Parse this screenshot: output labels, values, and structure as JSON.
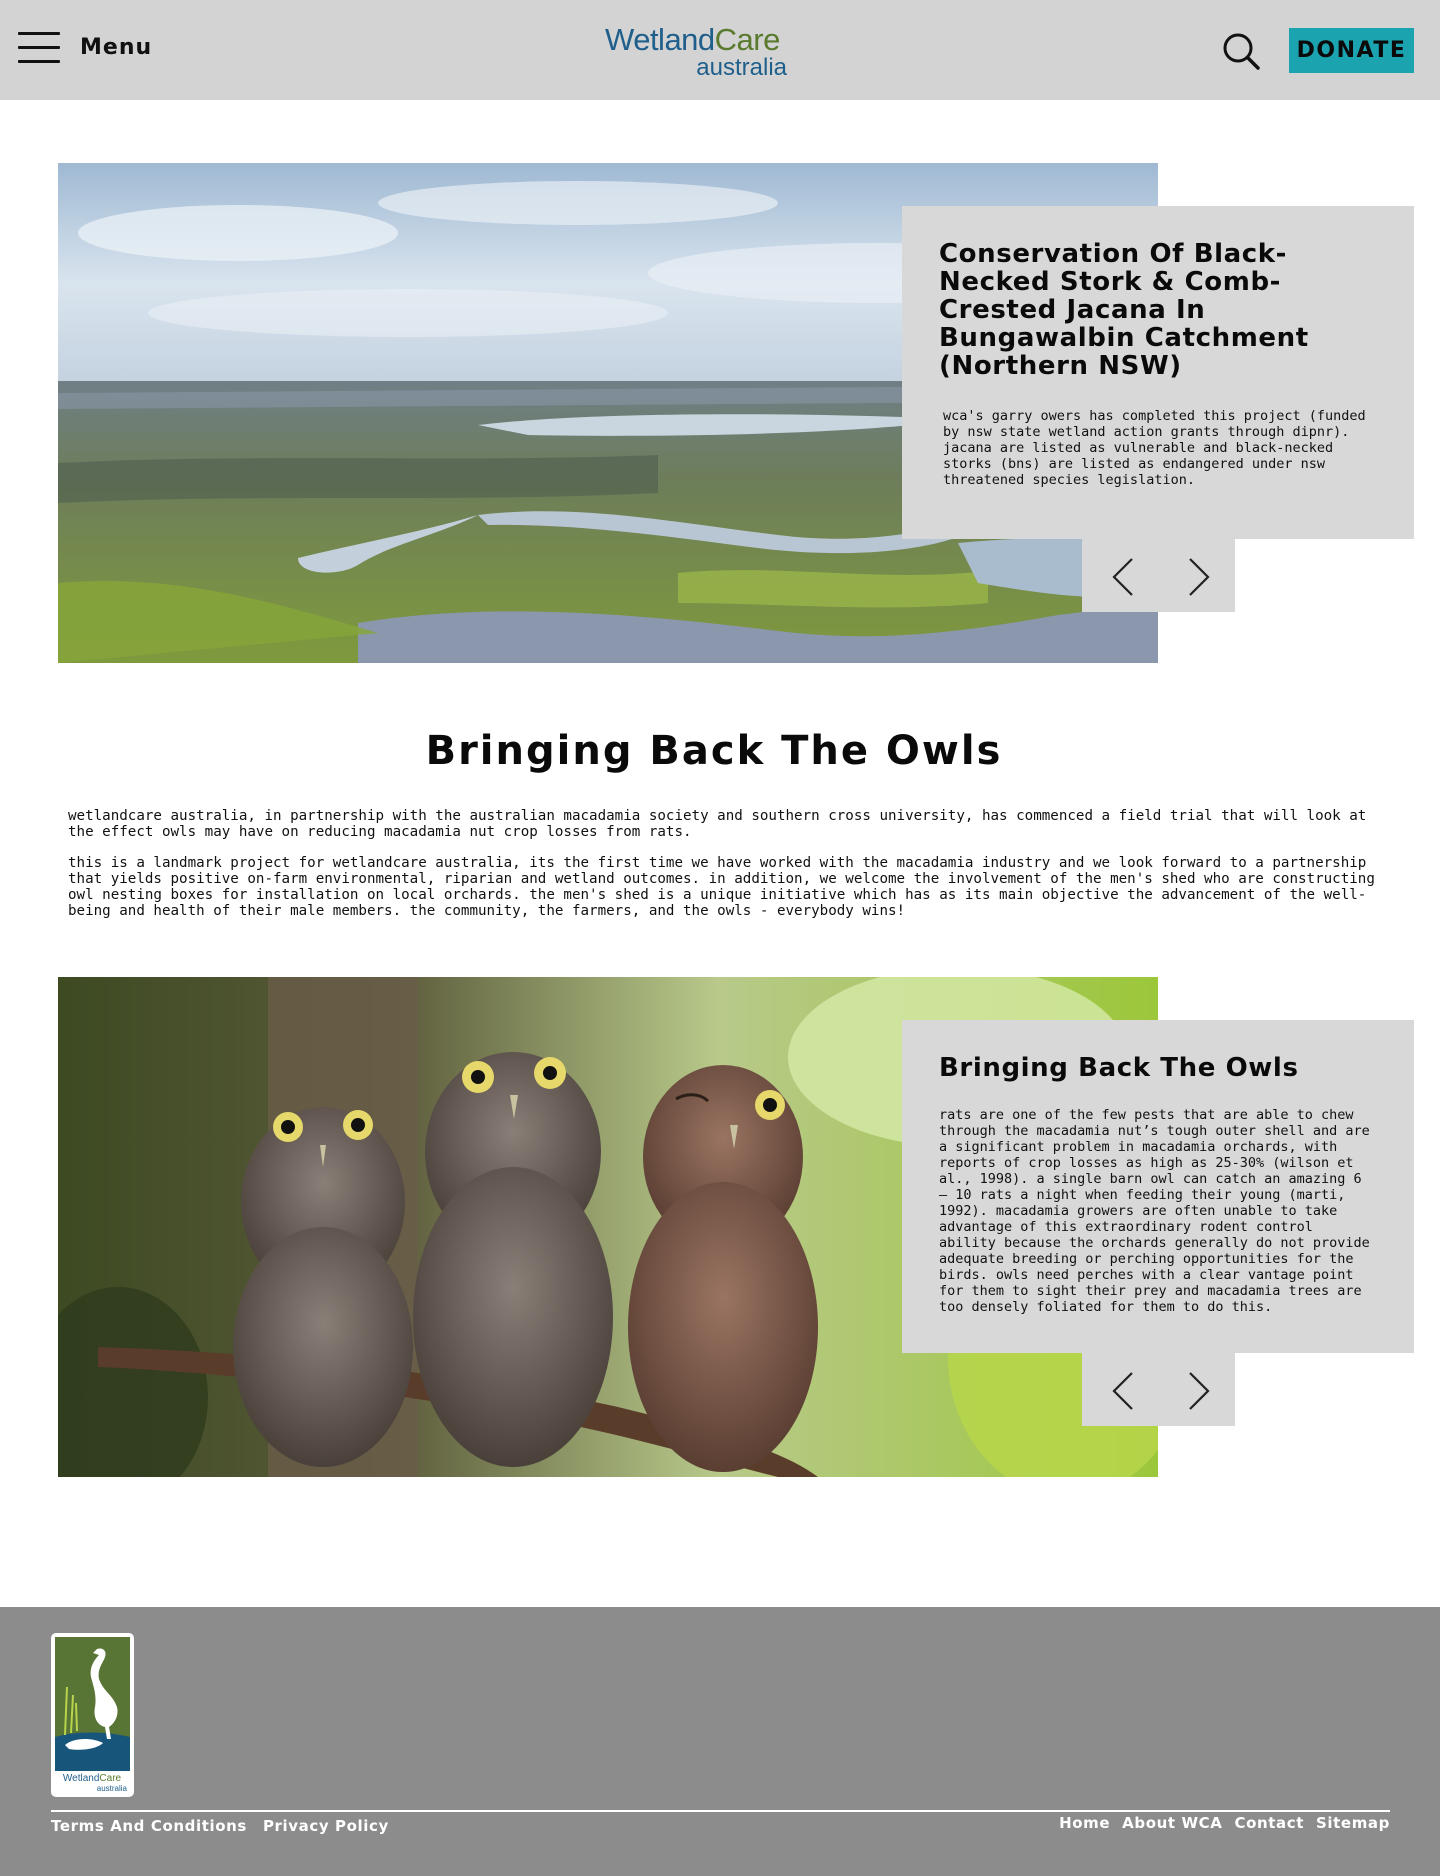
{
  "header": {
    "menu_label": "Menu",
    "logo_word1": "Wetland",
    "logo_word2": "Care",
    "logo_sub": "australia",
    "donate_label": "DONATE"
  },
  "colors": {
    "header_bg": "#d3d3d3",
    "donate_bg": "#1ba3b0",
    "brand_blue": "#1f5f8b",
    "brand_green": "#5a7a2e",
    "panel_bg": "#d8d8d8",
    "footer_bg": "#8c8c8c"
  },
  "icons": [
    "menu-icon",
    "search-icon",
    "chevron-left-icon",
    "chevron-right-icon"
  ],
  "slider1": {
    "image": "aerial-wetland-photo",
    "title": "Conservation Of Black-Necked Stork & Comb-Crested Jacana In Bungawalbin Catchment (Northern NSW)",
    "text": "wca's garry owers has completed this project (funded by nsw state wetland action grants through dipnr). jacana are listed as vulnerable and black-necked storks (bns) are listed as endangered under nsw threatened species legislation."
  },
  "main": {
    "title": "Bringing Back The Owls",
    "paragraphs": [
      "wetlandcare australia, in partnership with the australian macadamia society and southern cross university, has commenced a field trial that will look at the effect owls may have on reducing macadamia nut crop losses from rats.",
      "this is a landmark project for wetlandcare australia, its the first time we have worked with the macadamia industry and we look forward to a partnership that yields positive on-farm environmental, riparian and wetland outcomes. in addition, we welcome the involvement of the men's shed who are constructing owl nesting boxes for installation on local orchards. the men's shed is a unique initiative which has as its main objective the advancement of the well-being and health of their male members. the community, the farmers, and the owls - everybody wins!"
    ]
  },
  "slider2": {
    "image": "three-owls-photo",
    "title": "Bringing Back The Owls",
    "text": "rats are one of the few pests that are able to chew through the macadamia nut’s tough outer shell and are a significant problem in macadamia orchards, with reports of crop losses as high as 25-30% (wilson et al., 1998). a single barn owl can catch an amazing 6 – 10 rats a night when feeding their young (marti, 1992). macadamia growers are often unable to take advantage of this extraordinary rodent control ability because the orchards generally do not provide adequate breeding or perching opportunities for the birds. owls need perches with a clear vantage point for them to sight their prey and macadamia trees are too densely foliated for them to do this."
  },
  "footer": {
    "logo_word1": "Wetland",
    "logo_word2": "Care",
    "logo_sub": "australia",
    "links_left": [
      "Terms And Conditions",
      "Privacy Policy"
    ],
    "links_right": [
      "Home",
      "About WCA",
      "Contact",
      "Sitemap"
    ]
  }
}
